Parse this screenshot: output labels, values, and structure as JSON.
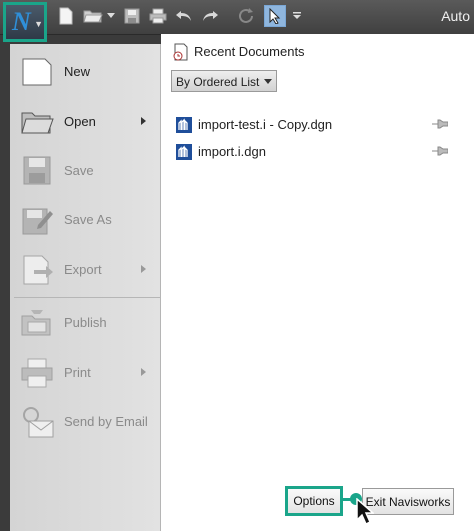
{
  "window": {
    "app_logo_letter": "N",
    "title": "Auto",
    "accent_color": "#1aa58a",
    "quick_access": [
      "new-icon",
      "open-icon",
      "dropdown-icon",
      "save-icon",
      "print-icon",
      "undo-icon",
      "redo-icon",
      "refresh-icon",
      "select-icon",
      "customize-icon"
    ]
  },
  "menu": {
    "items": [
      {
        "label": "New",
        "enabled": true,
        "submenu": false
      },
      {
        "label": "Open",
        "enabled": true,
        "submenu": true
      },
      {
        "label": "Save",
        "enabled": false,
        "submenu": false
      },
      {
        "label": "Save As",
        "enabled": false,
        "submenu": false
      },
      {
        "label": "Export",
        "enabled": false,
        "submenu": true
      },
      {
        "label": "Publish",
        "enabled": false,
        "submenu": false
      },
      {
        "label": "Print",
        "enabled": false,
        "submenu": true
      },
      {
        "label": "Send by Email",
        "enabled": false,
        "submenu": false
      }
    ]
  },
  "recent": {
    "heading": "Recent Documents",
    "sort_label": "By Ordered List",
    "documents": [
      {
        "name": "import-test.i - Copy.dgn"
      },
      {
        "name": "import.i.dgn"
      }
    ]
  },
  "footer": {
    "options_label": "Options",
    "exit_label": "Exit Navisworks"
  }
}
